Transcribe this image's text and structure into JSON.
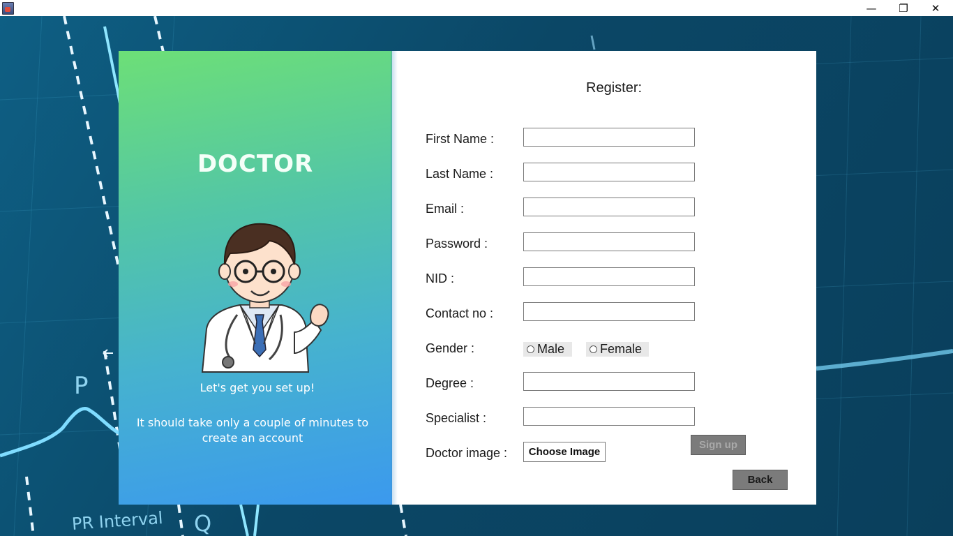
{
  "window": {
    "minimize_glyph": "—",
    "maximize_glyph": "❐",
    "close_glyph": "✕"
  },
  "background": {
    "label_p": "P",
    "label_pr_interval": "PR Interval",
    "label_q": "Q"
  },
  "left_panel": {
    "title": "DOCTOR",
    "tagline": "Let's get you set up!",
    "subtext": "It should take only a couple of minutes to create an account"
  },
  "form": {
    "title": "Register:",
    "labels": {
      "first_name": "First Name :",
      "last_name": "Last Name :",
      "email": "Email :",
      "password": "Password :",
      "nid": "NID :",
      "contact": "Contact no :",
      "gender": "Gender :",
      "degree": "Degree :",
      "specialist": "Specialist :",
      "doctor_image": "Doctor image :"
    },
    "values": {
      "first_name": "",
      "last_name": "",
      "email": "",
      "password": "",
      "nid": "",
      "contact": "",
      "degree": "",
      "specialist": ""
    },
    "gender_options": [
      "Male",
      "Female"
    ],
    "choose_image_label": "Choose Image",
    "signup_label": "Sign up",
    "back_label": "Back"
  }
}
